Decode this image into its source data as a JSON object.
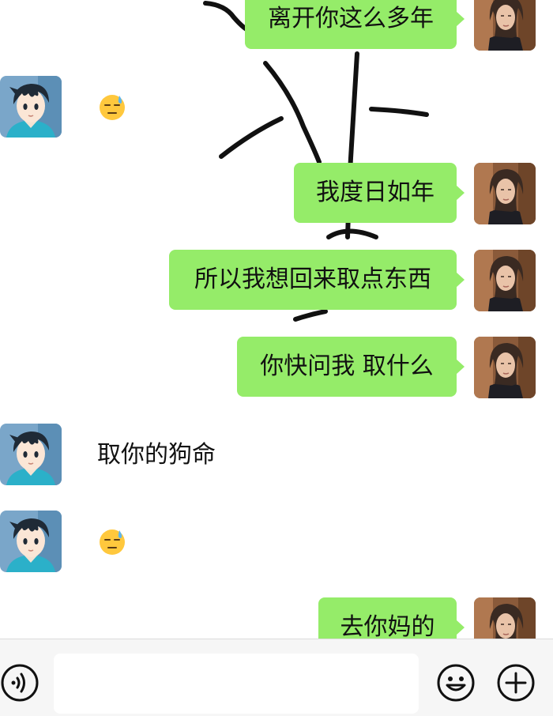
{
  "messages": [
    {
      "side": "right",
      "kind": "text",
      "text": "离开你这么多年"
    },
    {
      "side": "left",
      "kind": "emoji",
      "emoji": "sweat-face-emoji"
    },
    {
      "side": "right",
      "kind": "text",
      "text": "我度日如年"
    },
    {
      "side": "right",
      "kind": "text",
      "text": "所以我想回来取点东西"
    },
    {
      "side": "right",
      "kind": "text",
      "text": "你快问我 取什么"
    },
    {
      "side": "left",
      "kind": "text",
      "text": "取你的狗命"
    },
    {
      "side": "left",
      "kind": "emoji",
      "emoji": "sweat-face-emoji"
    },
    {
      "side": "right",
      "kind": "text",
      "text": "去你妈的"
    }
  ],
  "input_bar": {
    "input_value": "",
    "icons": [
      "voice-icon",
      "emoji-icon",
      "plus-icon"
    ]
  },
  "colors": {
    "bubble_green": "#95ec69",
    "background": "#ffffff",
    "input_bar_bg": "#f6f6f6"
  }
}
